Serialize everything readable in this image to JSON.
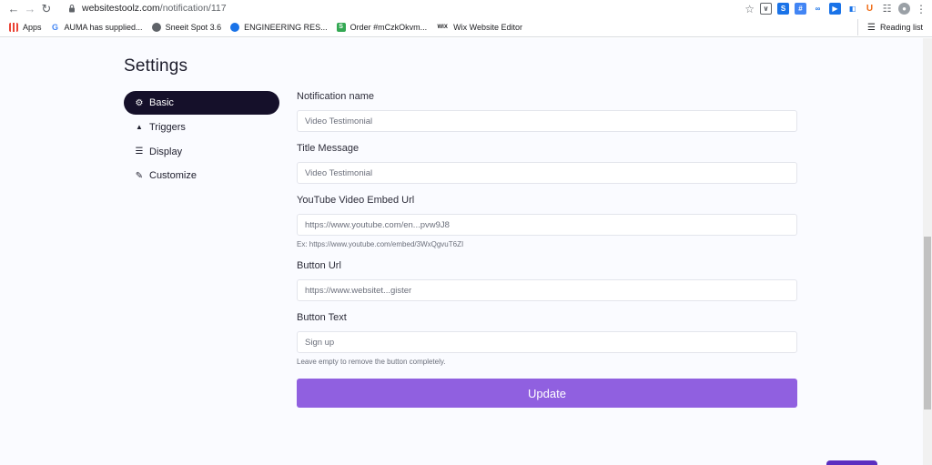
{
  "browser": {
    "url_host": "websitestoolz.com",
    "url_path": "/notification/117",
    "bookmarks": [
      {
        "label": "Apps",
        "icon": "apps-grid-icon",
        "color": "#ea4335"
      },
      {
        "label": "AUMA has supplied...",
        "icon": "google-icon",
        "color": "#4285f4"
      },
      {
        "label": "Sneeit Spot 3.6",
        "icon": "globe-icon",
        "color": "#5f6368"
      },
      {
        "label": "ENGINEERING RES...",
        "icon": "compass-icon",
        "color": "#1a73e8"
      },
      {
        "label": "Order #mCzkOkvm...",
        "icon": "shopify-icon",
        "color": "#34a853"
      },
      {
        "label": "Wix Website Editor",
        "icon": "wix-icon",
        "color": "#202124"
      }
    ],
    "reading_list": "Reading list"
  },
  "page": {
    "title": "Settings",
    "menu": [
      {
        "label": "Basic",
        "icon": "gear-icon",
        "active": true
      },
      {
        "label": "Triggers",
        "icon": "chevron-up-icon",
        "active": false
      },
      {
        "label": "Display",
        "icon": "bars-icon",
        "active": false
      },
      {
        "label": "Customize",
        "icon": "brush-icon",
        "active": false
      }
    ],
    "form": {
      "notification_name": {
        "label": "Notification name",
        "value": "Video Testimonial"
      },
      "title_message": {
        "label": "Title Message",
        "value": "Video Testimonial"
      },
      "youtube_url": {
        "label": "YouTube Video Embed Url",
        "value": "https://www.youtube.com/en...pvw9J8",
        "hint": "Ex: https://www.youtube.com/embed/3WxQgvuT6ZI"
      },
      "button_url": {
        "label": "Button Url",
        "value": "https://www.websitet...gister"
      },
      "button_text": {
        "label": "Button Text",
        "value": "Sign up",
        "hint": "Leave empty to remove the button completely."
      },
      "update_label": "Update"
    }
  },
  "colors": {
    "accent": "#9060e0",
    "active_menu_bg": "#15102a"
  }
}
